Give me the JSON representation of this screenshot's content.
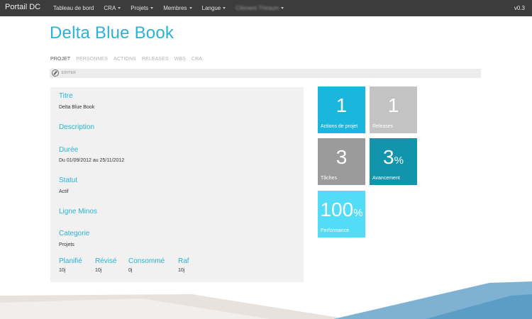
{
  "topbar": {
    "brand": "Portail DC",
    "nav": [
      {
        "label": "Tableau de bord",
        "caret": false
      },
      {
        "label": "CRA",
        "caret": true
      },
      {
        "label": "Projets",
        "caret": true
      },
      {
        "label": "Membres",
        "caret": true
      },
      {
        "label": "Langue",
        "caret": true
      }
    ],
    "user": "Clément Thiraum",
    "version": "v0.3"
  },
  "page": {
    "title": "Delta Blue Book"
  },
  "tabs": [
    "PROJET",
    "PERSONNES",
    "ACTIONS",
    "RELEASES",
    "WBS",
    "CRA"
  ],
  "active_tab": "PROJET",
  "editbar": {
    "label": "EDITER"
  },
  "details": {
    "titre_label": "Titre",
    "titre_value": "Delta Blue Book",
    "description_label": "Description",
    "duree_label": "Durée",
    "duree_value": "Du 01/09/2012 au 25/11/2012",
    "statut_label": "Statut",
    "statut_value": "Actif",
    "ligne_label": "Ligne Minos",
    "categorie_label": "Categorie",
    "categorie_value": "Projets",
    "planifie_label": "Planifié",
    "planifie_value": "10j",
    "revise_label": "Révisé",
    "revise_value": "10j",
    "consomme_label": "Consommé",
    "consomme_value": "0j",
    "raf_label": "Raf",
    "raf_value": "10j"
  },
  "tiles": {
    "actions": {
      "value": "1",
      "label": "Actions de projet",
      "color": "#1bb6dc"
    },
    "releases": {
      "value": "1",
      "label": "Releases",
      "color": "#c3c3c3"
    },
    "taches": {
      "value": "3",
      "label": "Tâches",
      "color": "#9b9b9b"
    },
    "avancement": {
      "value": "3",
      "unit": "%",
      "label": "Avancement",
      "color": "#1294ad"
    },
    "performance": {
      "value": "100",
      "unit": "%",
      "label": "Performance",
      "color": "#53dcf7"
    }
  },
  "colors": {
    "accent": "#29b3d7",
    "topbar": "#3c3c3c",
    "panel": "#f1f1f1"
  }
}
